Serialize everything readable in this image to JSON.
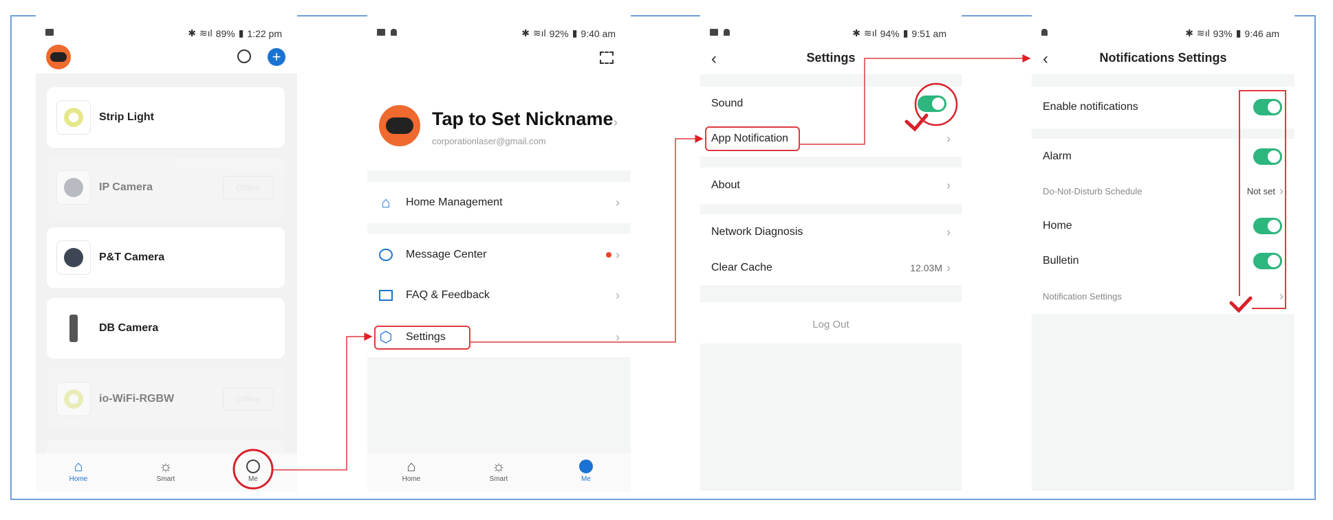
{
  "panels": {
    "home": {
      "status": {
        "battery": "89%",
        "time": "1:22 pm"
      },
      "devices": [
        {
          "name": "Strip Light",
          "online": true
        },
        {
          "name": "IP Camera",
          "online": false,
          "badge": "Offline"
        },
        {
          "name": "P&T Camera",
          "online": true
        },
        {
          "name": "DB Camera",
          "online": true
        },
        {
          "name": "io-WiFi-RGBW",
          "online": false,
          "badge": "Offline"
        }
      ],
      "nav": [
        "Home",
        "Smart",
        "Me"
      ]
    },
    "me": {
      "status": {
        "battery": "92%",
        "time": "9:40 am"
      },
      "nickname": "Tap to Set Nickname",
      "email": "corporationlaser@gmail.com",
      "menu": [
        "Home Management",
        "Message Center",
        "FAQ & Feedback",
        "Settings"
      ],
      "nav": [
        "Home",
        "Smart",
        "Me"
      ]
    },
    "settings": {
      "status": {
        "battery": "94%",
        "time": "9:51 am"
      },
      "title": "Settings",
      "items": {
        "sound": "Sound",
        "app_notification": "App Notification",
        "about": "About",
        "network": "Network Diagnosis",
        "cache": "Clear Cache",
        "cache_size": "12.03M",
        "logout": "Log Out"
      },
      "sound_on": true
    },
    "notifications": {
      "status": {
        "battery": "93%",
        "time": "9:46 am"
      },
      "title": "Notifications Settings",
      "items": {
        "enable": "Enable notifications",
        "alarm": "Alarm",
        "dnd": "Do-Not-Disturb Schedule",
        "dnd_value": "Not set",
        "home": "Home",
        "bulletin": "Bulletin",
        "notif_settings": "Notification Settings"
      },
      "toggles": {
        "enable": true,
        "alarm": true,
        "home": true,
        "bulletin": true
      }
    }
  },
  "colors": {
    "accent": "#1a73d2",
    "toggle": "#2db67e",
    "annotation": "#d9202a",
    "frame": "#6e9fd8"
  }
}
